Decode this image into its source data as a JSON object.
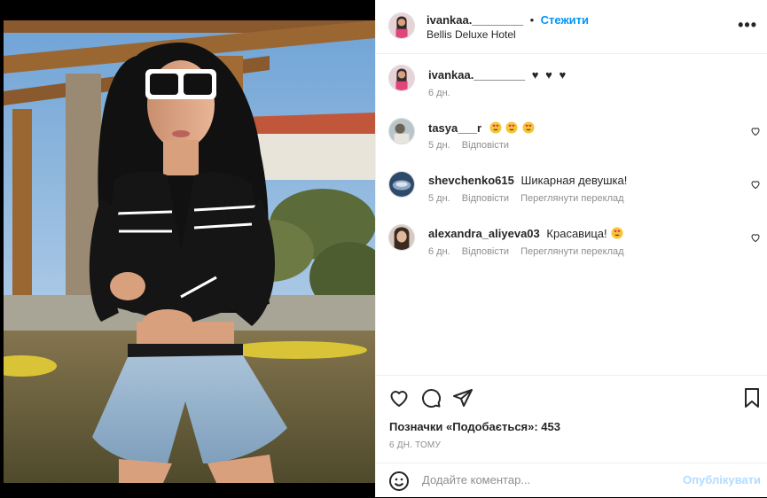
{
  "post": {
    "username": "ivankaa.________",
    "follow_label": "Стежити",
    "location": "Bellis Deluxe Hotel",
    "more_label": "•••"
  },
  "caption": {
    "username": "ivankaa.________",
    "text": "♥ ♥ ♥",
    "time": "6 дн."
  },
  "comments": [
    {
      "username": "tasya___r",
      "text": "",
      "emoji_count": 3,
      "time": "5 дн.",
      "reply": "Відповісти",
      "translate": ""
    },
    {
      "username": "shevchenko615",
      "text": "Шикарная девушка!",
      "emoji_count": 0,
      "time": "5 дн.",
      "reply": "Відповісти",
      "translate": "Переглянути переклад"
    },
    {
      "username": "alexandra_aliyeva03",
      "text": "Красавица!",
      "emoji_count": 1,
      "time": "6 дн.",
      "reply": "Відповісти",
      "translate": "Переглянути переклад"
    }
  ],
  "likes_text": "Позначки «Подобається»: 453",
  "posted_time": "6 ДН. ТОМУ",
  "comment_box": {
    "placeholder": "Додайте коментар...",
    "publish_label": "Опублікувати"
  },
  "colors": {
    "accent": "#0095f6",
    "publish_disabled": "#b3dbff",
    "muted": "#8e8e8e",
    "text": "#262626"
  }
}
